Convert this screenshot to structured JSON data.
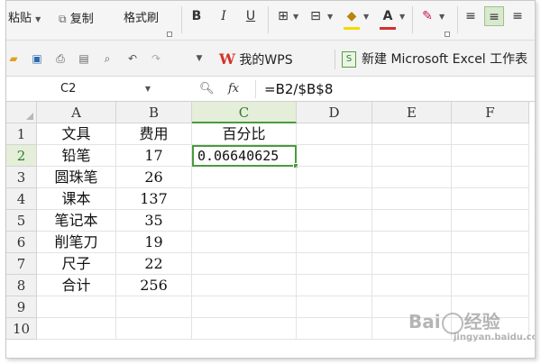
{
  "ribbon": {
    "paste_label": "粘贴",
    "copy_label": "复制",
    "format_painter_label": "格式刷",
    "bold": "B",
    "italic": "I",
    "underline": "U",
    "font_color_glyph": "A",
    "align_icons": [
      "align-left-icon",
      "align-center-icon",
      "align-right-icon"
    ],
    "colors": {
      "font_color": "#d32f2f",
      "highlight": "#f6d800",
      "accent": "#4a9a3f"
    }
  },
  "tabs": [
    {
      "label": "我的WPS",
      "logo": "W"
    },
    {
      "label": "新建 Microsoft Excel 工作表",
      "logo": "S"
    }
  ],
  "formula_bar": {
    "name_box": "C2",
    "fx": "fx",
    "formula": "=B2/$B$8"
  },
  "sheet": {
    "columns": [
      "A",
      "B",
      "C",
      "D",
      "E",
      "F"
    ],
    "rows": [
      "1",
      "2",
      "3",
      "4",
      "5",
      "6",
      "7",
      "8",
      "9",
      "10"
    ],
    "active_cell": "C2",
    "cells": [
      [
        "文具",
        "费用",
        "百分比"
      ],
      [
        "铅笔",
        "17",
        "0.06640625"
      ],
      [
        "圆珠笔",
        "26",
        ""
      ],
      [
        "课本",
        "137",
        ""
      ],
      [
        "笔记本",
        "35",
        ""
      ],
      [
        "削笔刀",
        "19",
        ""
      ],
      [
        "尺子",
        "22",
        ""
      ],
      [
        "合计",
        "256",
        ""
      ],
      [
        "",
        "",
        ""
      ],
      [
        "",
        "",
        ""
      ]
    ]
  },
  "watermark": {
    "text": "Bai",
    "text2": "经验",
    "sub": "jingyan.baidu.com"
  }
}
